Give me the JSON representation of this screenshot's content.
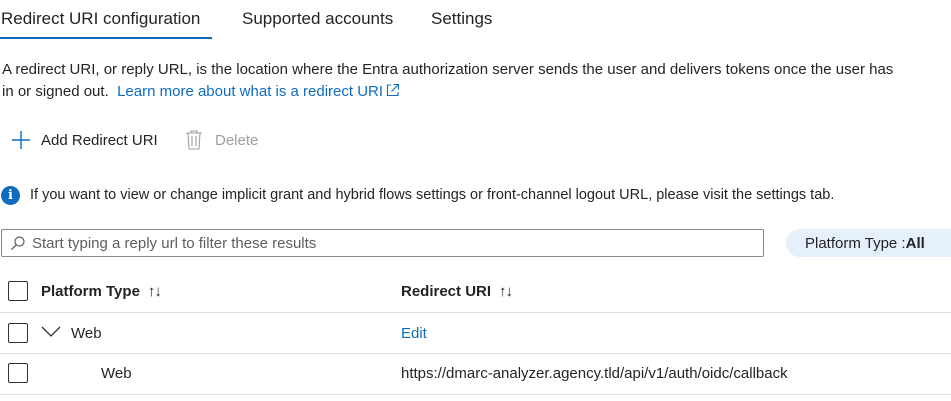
{
  "tabs": [
    {
      "label": "Redirect URI configuration",
      "active": true
    },
    {
      "label": "Supported accounts",
      "active": false
    },
    {
      "label": "Settings",
      "active": false
    }
  ],
  "description": {
    "line1": "A redirect URI, or reply URL, is the location where the Entra authorization server sends the user and delivers tokens once the user has",
    "line2": "in or signed out.",
    "link": "Learn more about what is a redirect URI"
  },
  "toolbar": {
    "add_label": "Add Redirect URI",
    "delete_label": "Delete"
  },
  "info": {
    "text": "If you want to view or change implicit grant and hybrid flows settings or front-channel logout URL, please visit the settings tab."
  },
  "filter": {
    "placeholder": "Start typing a reply url to filter these results",
    "platform_label": "Platform Type : ",
    "platform_value": "All"
  },
  "table": {
    "columns": [
      "Platform Type",
      "Redirect URI"
    ],
    "group": {
      "platform": "Web",
      "action": "Edit"
    },
    "rows": [
      {
        "platform": "Web",
        "uri": "https://dmarc-analyzer.agency.tld/api/v1/auth/oidc/callback"
      }
    ]
  },
  "colors": {
    "accent": "#0f6cbd",
    "pill_bg": "#e6f0fb",
    "disabled": "#a19f9d"
  }
}
